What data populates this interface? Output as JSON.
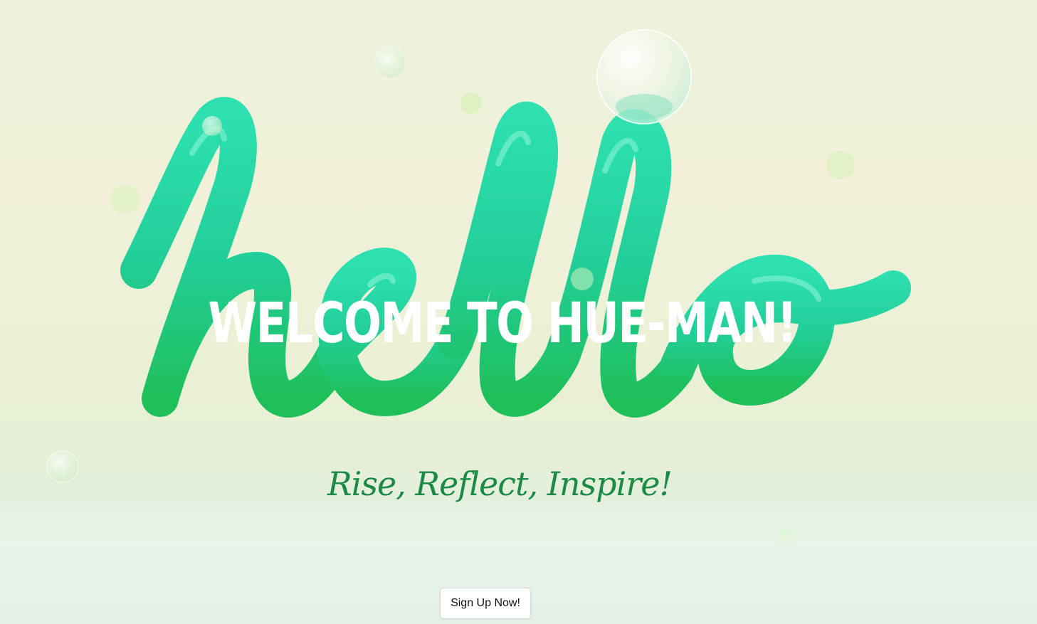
{
  "hero": {
    "background_word": "hello",
    "title": "WELCOME TO HUE-MAN!",
    "tagline": "Rise, Reflect, Inspire!",
    "cta_label": "Sign Up Now!"
  },
  "colors": {
    "background": "#eef1d9",
    "balloon_green": "#22c55e",
    "balloon_teal": "#2dd4a8",
    "tagline_green": "#1a8a45",
    "title_white": "#ffffff"
  }
}
